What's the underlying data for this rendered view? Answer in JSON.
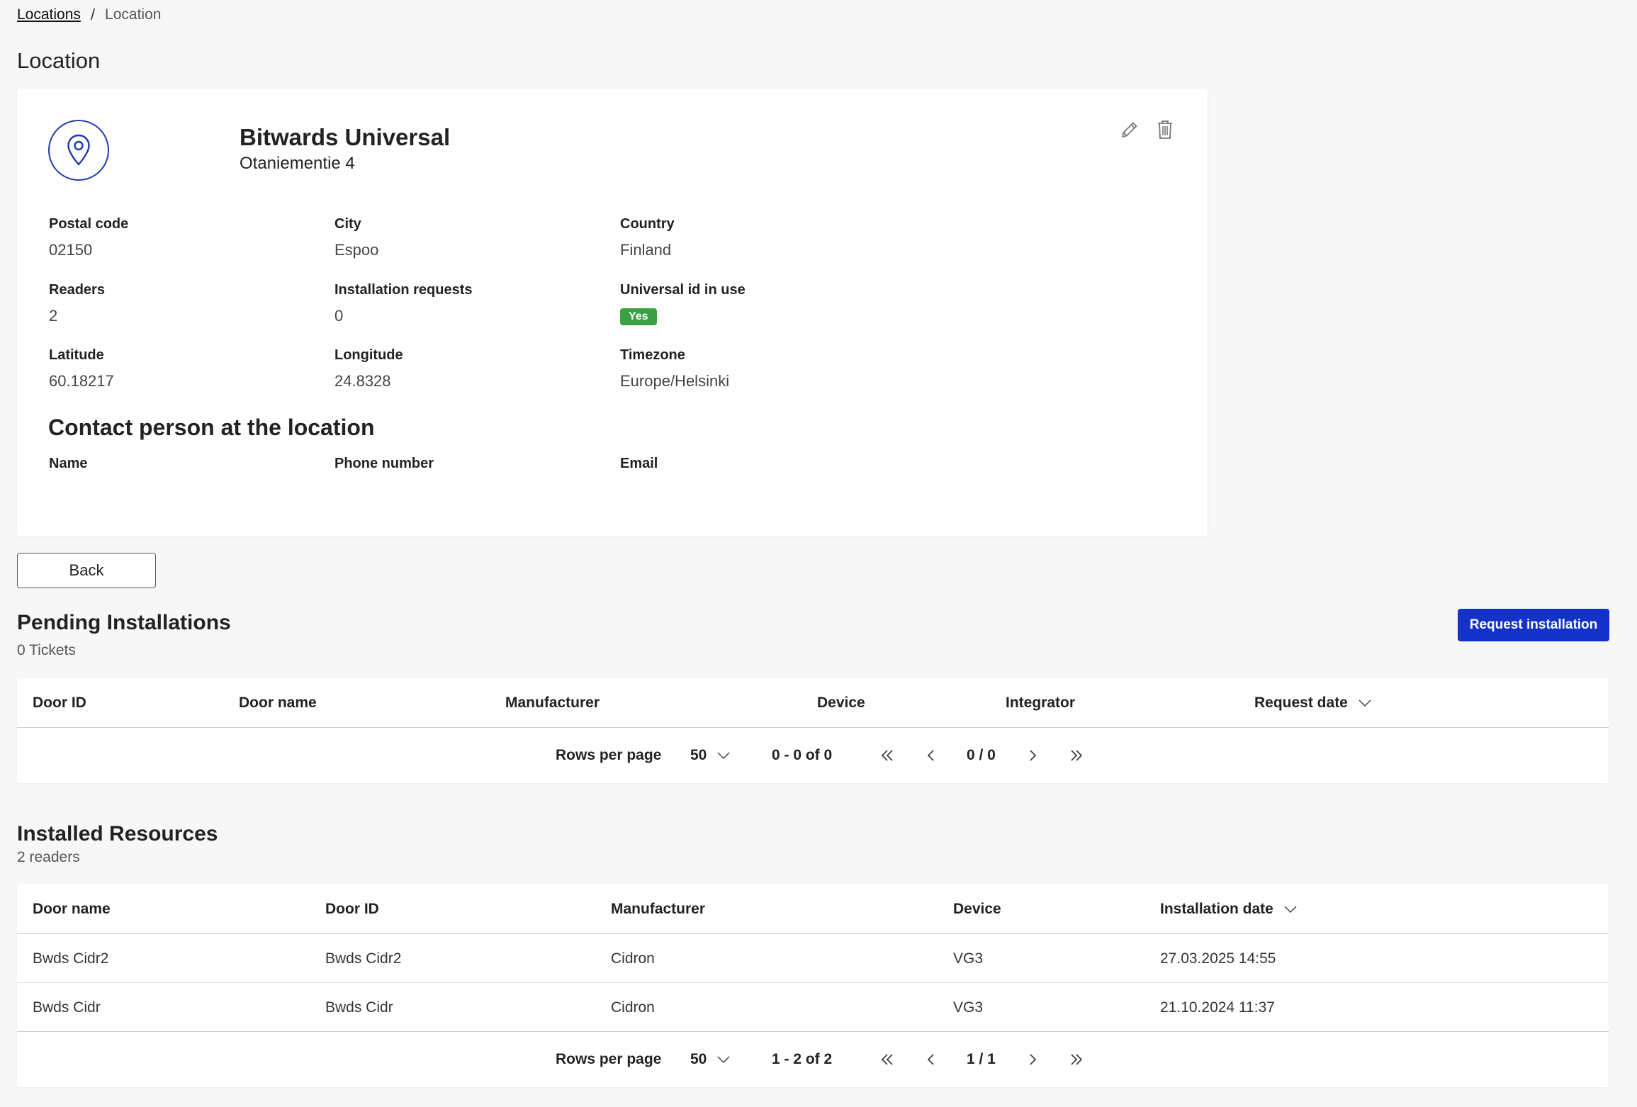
{
  "breadcrumb": {
    "parent": "Locations",
    "separator": "/",
    "current": "Location"
  },
  "page_title": "Location",
  "location": {
    "name": "Bitwards Universal",
    "address": "Otaniementie 4",
    "fields": {
      "postal_code": {
        "label": "Postal code",
        "value": "02150"
      },
      "city": {
        "label": "City",
        "value": "Espoo"
      },
      "country": {
        "label": "Country",
        "value": "Finland"
      },
      "readers": {
        "label": "Readers",
        "value": "2"
      },
      "installation_requests": {
        "label": "Installation requests",
        "value": "0"
      },
      "universal_id": {
        "label": "Universal id in use",
        "value": "Yes"
      },
      "latitude": {
        "label": "Latitude",
        "value": "60.18217"
      },
      "longitude": {
        "label": "Longitude",
        "value": "24.8328"
      },
      "timezone": {
        "label": "Timezone",
        "value": "Europe/Helsinki"
      }
    },
    "contact": {
      "title": "Contact person at the location",
      "name_label": "Name",
      "phone_label": "Phone number",
      "email_label": "Email"
    }
  },
  "back_label": "Back",
  "pending": {
    "title": "Pending Installations",
    "subtitle": "0 Tickets",
    "request_button": "Request installation",
    "columns": [
      "Door ID",
      "Door name",
      "Manufacturer",
      "Device",
      "Integrator",
      "Request date"
    ],
    "pager": {
      "rows_label": "Rows per page",
      "rows_value": "50",
      "range": "0 - 0 of 0",
      "page": "0 / 0"
    }
  },
  "installed": {
    "title": "Installed Resources",
    "subtitle": "2 readers",
    "columns": [
      "Door name",
      "Door ID",
      "Manufacturer",
      "Device",
      "Installation date"
    ],
    "rows": [
      [
        "Bwds Cidr2",
        "Bwds Cidr2",
        "Cidron",
        "VG3",
        "27.03.2025 14:55"
      ],
      [
        "Bwds Cidr",
        "Bwds Cidr",
        "Cidron",
        "VG3",
        "21.10.2024 11:37"
      ]
    ],
    "pager": {
      "rows_label": "Rows per page",
      "rows_value": "50",
      "range": "1 - 2 of 2",
      "page": "1 / 1"
    }
  },
  "colors": {
    "accent": "#1232c9",
    "badge_green": "#3aa142",
    "icon_blue": "#1f3bb3"
  }
}
